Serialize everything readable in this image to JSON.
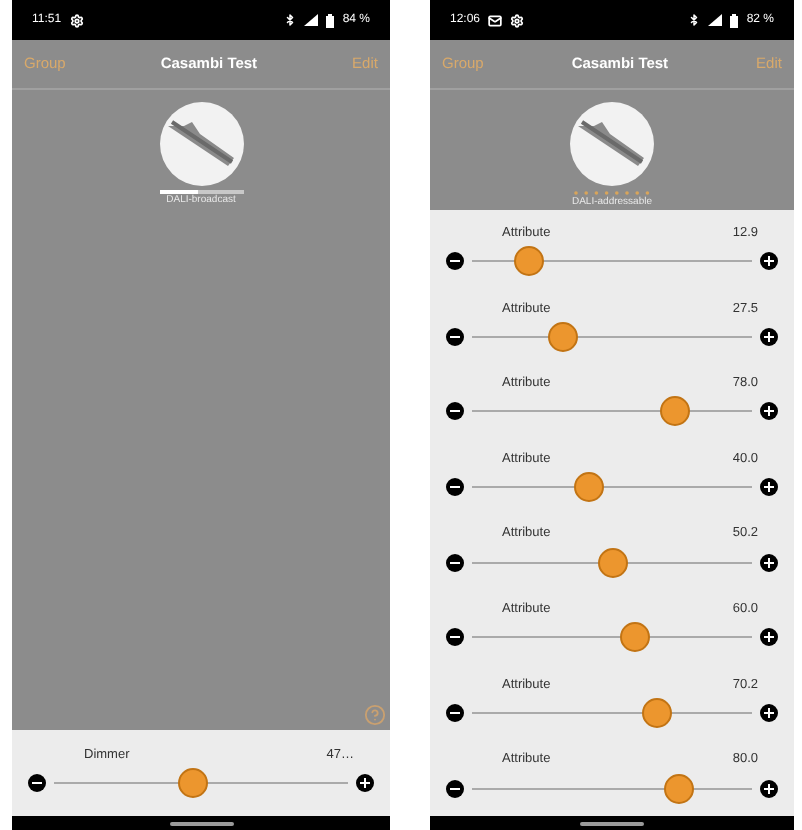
{
  "phones": [
    {
      "status_bar": {
        "time": "11:51",
        "notification_icons": [
          {
            "kind": "gear"
          }
        ],
        "battery": "84 %"
      },
      "header": {
        "left": "Group",
        "title": "Casambi Test",
        "right": "Edit"
      },
      "device": {
        "label": "DALI-broadcast",
        "kind": "bar",
        "level": 0.47
      },
      "help_button": true,
      "controls": [
        {
          "label": "Dimmer",
          "value": "47…",
          "level": 0.47
        }
      ]
    },
    {
      "status_bar": {
        "time": "12:06",
        "notification_icons": [
          {
            "kind": "mail"
          },
          {
            "kind": "gear"
          }
        ],
        "battery": "82 %"
      },
      "header": {
        "left": "Group",
        "title": "Casambi Test",
        "right": "Edit"
      },
      "device": {
        "label": "DALI-addressable",
        "kind": "dots"
      },
      "help_button": false,
      "controls": [
        {
          "label": "Attribute",
          "value": "12.9",
          "level": 0.17
        },
        {
          "label": "Attribute",
          "value": "27.5",
          "level": 0.3
        },
        {
          "label": "Attribute",
          "value": "78.0",
          "level": 0.75
        },
        {
          "label": "Attribute",
          "value": "40.0",
          "level": 0.41
        },
        {
          "label": "Attribute",
          "value": "50.2",
          "level": 0.5
        },
        {
          "label": "Attribute",
          "value": "60.0",
          "level": 0.59
        },
        {
          "label": "Attribute",
          "value": "70.2",
          "level": 0.68
        },
        {
          "label": "Attribute",
          "value": "80.0",
          "level": 0.77
        }
      ]
    }
  ]
}
